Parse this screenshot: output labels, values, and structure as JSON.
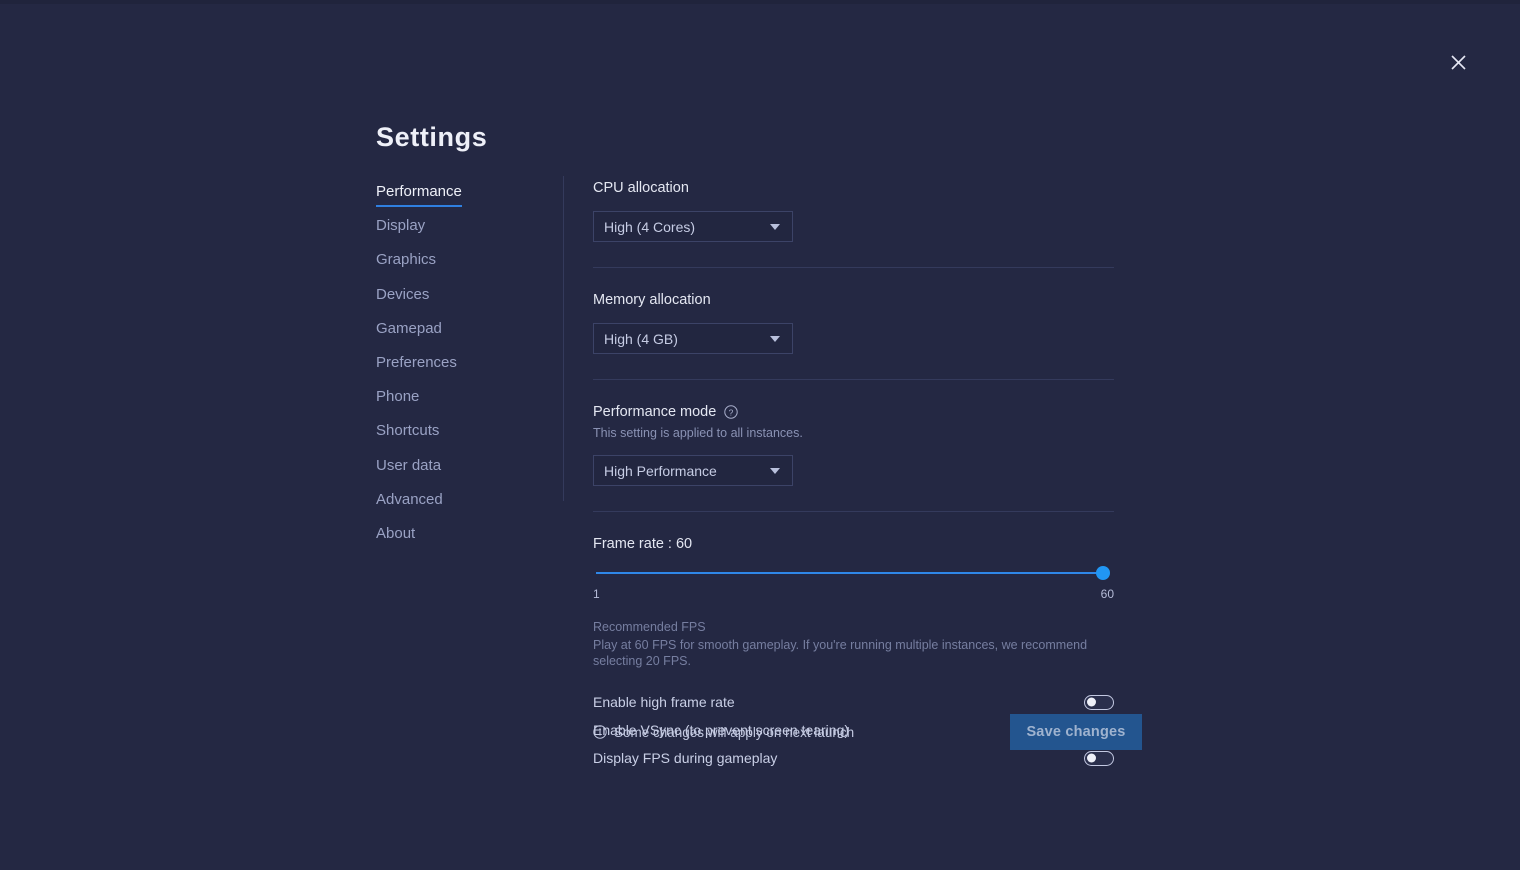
{
  "window": {
    "title": "Settings",
    "close_icon": "close-icon"
  },
  "sidebar": {
    "items": [
      {
        "label": "Performance",
        "active": true
      },
      {
        "label": "Display",
        "active": false
      },
      {
        "label": "Graphics",
        "active": false
      },
      {
        "label": "Devices",
        "active": false
      },
      {
        "label": "Gamepad",
        "active": false
      },
      {
        "label": "Preferences",
        "active": false
      },
      {
        "label": "Phone",
        "active": false
      },
      {
        "label": "Shortcuts",
        "active": false
      },
      {
        "label": "User data",
        "active": false
      },
      {
        "label": "Advanced",
        "active": false
      },
      {
        "label": "About",
        "active": false
      }
    ]
  },
  "content": {
    "cpu": {
      "label": "CPU allocation",
      "value": "High (4 Cores)"
    },
    "memory": {
      "label": "Memory allocation",
      "value": "High (4 GB)"
    },
    "performance_mode": {
      "label": "Performance mode",
      "help_icon": "help-circle-icon",
      "description": "This setting is applied to all instances.",
      "value": "High Performance"
    },
    "frame_rate": {
      "label": "Frame rate : 60",
      "value": 60,
      "min_label": "1",
      "max_label": "60",
      "min": 1,
      "max": 60,
      "recommended_title": "Recommended FPS",
      "recommended_text": "Play at 60 FPS for smooth gameplay. If you're running multiple instances, we recommend selecting 20 FPS."
    },
    "toggles": [
      {
        "label": "Enable high frame rate",
        "on": false
      },
      {
        "label": "Enable VSync (to prevent screen tearing)",
        "on": false
      },
      {
        "label": "Display FPS during gameplay",
        "on": false
      }
    ]
  },
  "footer": {
    "info_icon": "info-circle-icon",
    "note": "Some changes will apply on next launch",
    "save_label": "Save changes"
  },
  "colors": {
    "background": "#242843",
    "accent": "#2196f3",
    "accent_underline": "#2f7fe0",
    "save_button": "#23558f",
    "text_primary": "#eef0f8",
    "text_muted": "#8a92b4"
  }
}
